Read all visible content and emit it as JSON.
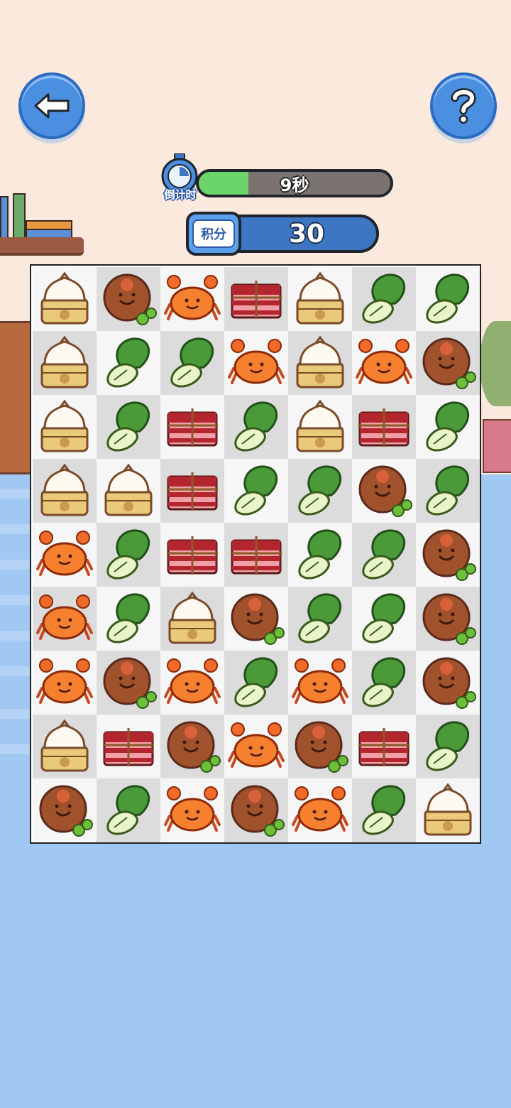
{
  "hud": {
    "timer_text": "9秒",
    "timer_label": "倒计时",
    "timer_fraction": 0.26,
    "score_label": "积分",
    "score_value": "30"
  },
  "buttons": {
    "back_icon": "back-arrow-icon",
    "help_icon": "question-mark-icon"
  },
  "colors": {
    "button_blue": "#4a8fe0",
    "timer_green": "#6bd46a",
    "score_blue": "#3d77c4",
    "wall": "#fbe9de",
    "floor": "#a0c8f2"
  },
  "board": {
    "rows": [
      [
        "bun",
        "meatball",
        "crab",
        "pork",
        "bun",
        "bokchoy",
        "bokchoy"
      ],
      [
        "bun",
        "bokchoy",
        "bokchoy",
        "crab",
        "bun",
        "crab",
        "meatball"
      ],
      [
        "bun",
        "bokchoy",
        "pork",
        "bokchoy",
        "bun",
        "pork",
        "bokchoy"
      ],
      [
        "bun",
        "bun",
        "pork",
        "bokchoy",
        "bokchoy",
        "meatball",
        "bokchoy"
      ],
      [
        "crab",
        "bokchoy",
        "pork",
        "pork",
        "bokchoy",
        "bokchoy",
        "meatball"
      ],
      [
        "crab",
        "bokchoy",
        "bun",
        "meatball",
        "bokchoy",
        "bokchoy",
        "meatball"
      ],
      [
        "crab",
        "meatball",
        "crab",
        "bokchoy",
        "crab",
        "bokchoy",
        "meatball"
      ],
      [
        "bun",
        "pork",
        "meatball",
        "crab",
        "meatball",
        "pork",
        "bokchoy"
      ],
      [
        "meatball",
        "bokchoy",
        "crab",
        "meatball",
        "crab",
        "bokchoy",
        "bun"
      ]
    ]
  }
}
